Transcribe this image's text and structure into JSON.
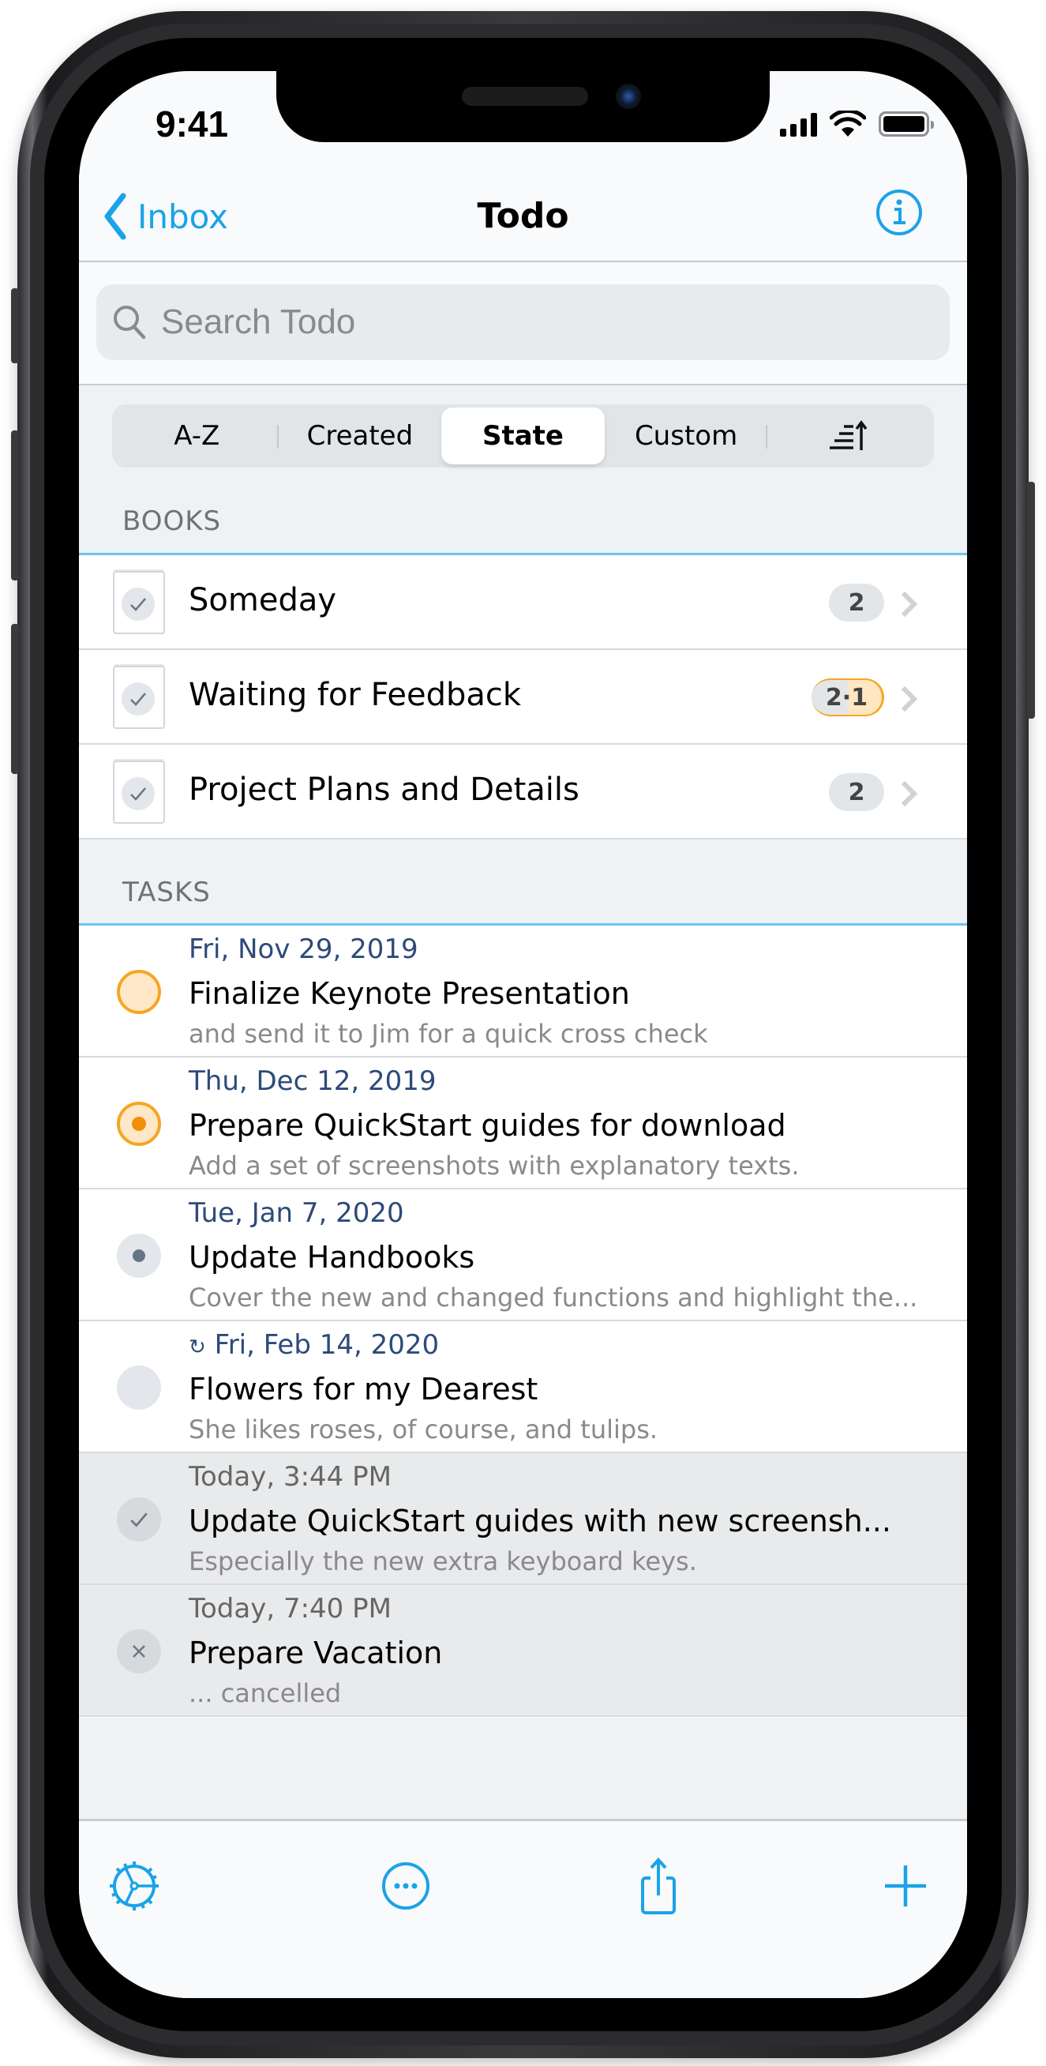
{
  "status_bar": {
    "time": "9:41",
    "icons": [
      "signal-icon",
      "wifi-icon",
      "battery-icon"
    ]
  },
  "nav": {
    "back_label": "Inbox",
    "title": "Todo",
    "info_icon": "info-icon"
  },
  "search": {
    "placeholder": "Search Todo",
    "value": ""
  },
  "sort": {
    "segments": [
      "A-Z",
      "Created",
      "State",
      "Custom"
    ],
    "selected": "State",
    "direction_icon": "sort-ascending-icon"
  },
  "books": {
    "header": "BOOKS",
    "items": [
      {
        "title": "Someday",
        "badge": "2"
      },
      {
        "title": "Waiting for Feedback",
        "badge": "2·1"
      },
      {
        "title": "Project Plans and Details",
        "badge": "2"
      }
    ]
  },
  "tasks": {
    "header": "TASKS",
    "items": [
      {
        "date": "Fri, Nov 29, 2019",
        "title": "Finalize Keynote Presentation",
        "note": "and send it to Jim for a quick cross check",
        "state": "open-priority"
      },
      {
        "date": "Thu, Dec 12, 2019",
        "title": "Prepare QuickStart guides for download",
        "note": "Add a set of screenshots with explanatory texts.",
        "state": "in-progress-priority"
      },
      {
        "date": "Tue, Jan 7, 2020",
        "title": "Update Handbooks",
        "note": "Cover the new and changed functions and highlight the...",
        "state": "in-progress"
      },
      {
        "date": "Fri, Feb 14, 2020",
        "recurring_icon": "↻",
        "title": "Flowers for my Dearest",
        "note": "She likes roses, of course, and tulips.",
        "state": "open"
      },
      {
        "date": "Today, 3:44 PM",
        "title": "Update QuickStart guides with new screensh...",
        "note": "Especially the new extra keyboard keys.",
        "state": "done"
      },
      {
        "date": "Today, 7:40 PM",
        "title": "Prepare Vacation",
        "note": "... cancelled",
        "state": "cancelled"
      }
    ]
  },
  "toolbar": {
    "buttons": [
      "settings-icon",
      "more-icon",
      "share-icon",
      "add-icon"
    ]
  },
  "colors": {
    "accent": "#1aa3e8",
    "priority": "#f5a623",
    "date": "#2d4a7a",
    "section_line": "#6fc3eb"
  }
}
